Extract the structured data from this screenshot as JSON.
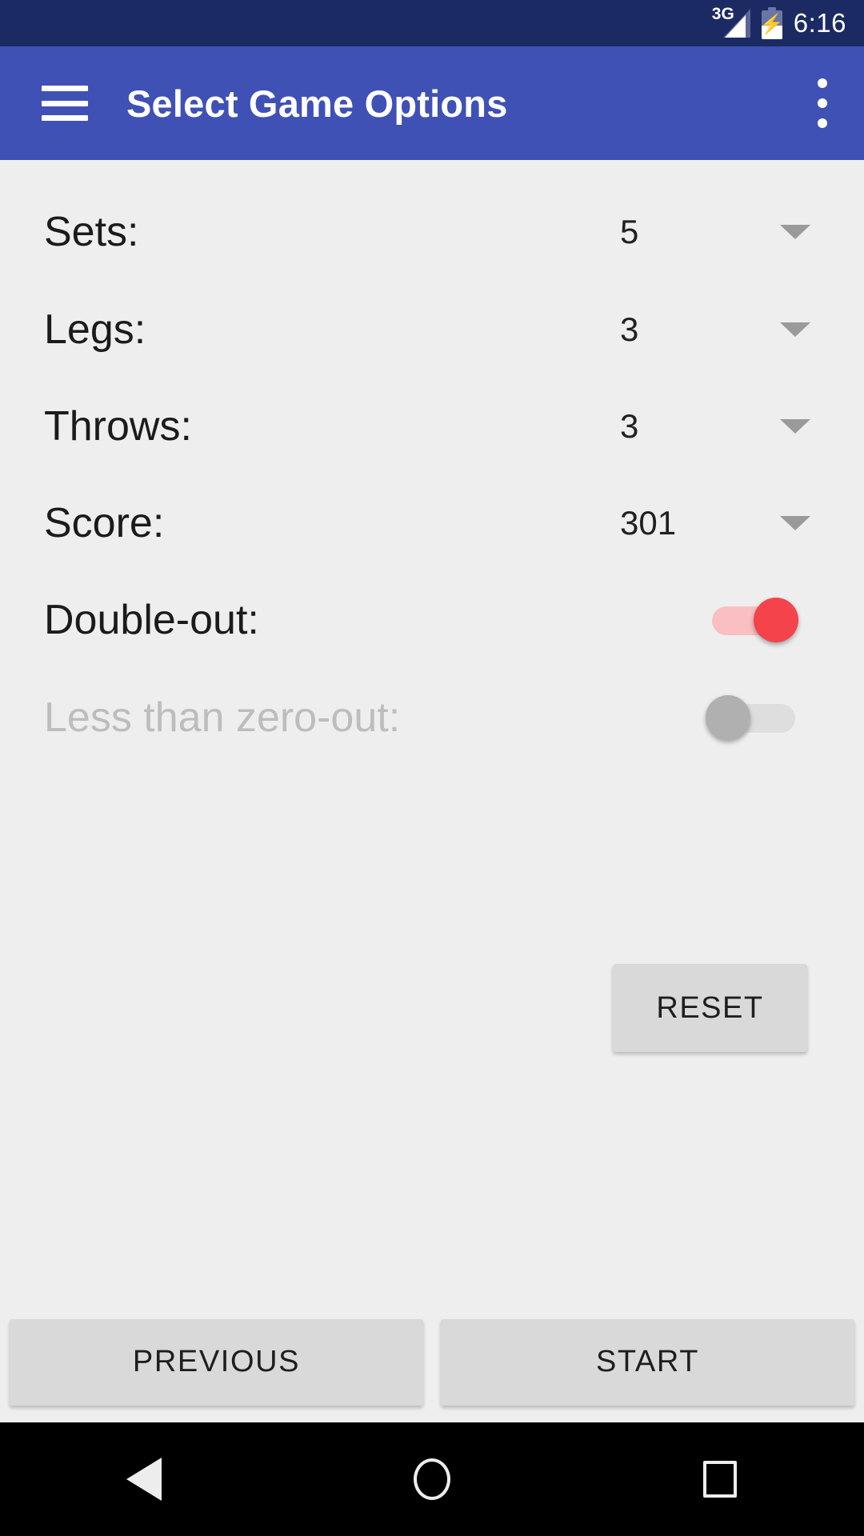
{
  "status_bar": {
    "network_label": "3G",
    "battery_state": "charging",
    "time": "6:16",
    "background_color": "#1c2a63"
  },
  "app_bar": {
    "title": "Select Game Options",
    "menu_icon": "hamburger-menu-icon",
    "overflow_icon": "overflow-menu-icon",
    "background_color": "#3f51b5"
  },
  "options": [
    {
      "label": "Sets:",
      "value": "5",
      "control": "dropdown",
      "disabled": false
    },
    {
      "label": "Legs:",
      "value": "3",
      "control": "dropdown",
      "disabled": false
    },
    {
      "label": "Throws:",
      "value": "3",
      "control": "dropdown",
      "disabled": false
    },
    {
      "label": "Score:",
      "value": "301",
      "control": "dropdown",
      "disabled": false
    },
    {
      "label": "Double-out:",
      "value": "on",
      "control": "switch",
      "disabled": false
    },
    {
      "label": "Less than zero-out:",
      "value": "off",
      "control": "switch",
      "disabled": true
    }
  ],
  "reset_button": {
    "label": "RESET"
  },
  "bottom_buttons": {
    "previous_label": "PREVIOUS",
    "start_label": "START"
  },
  "system_nav": {
    "back": "back-icon",
    "home": "home-icon",
    "recents": "recents-icon"
  },
  "colors": {
    "toggle_on_thumb": "#f4434a",
    "toggle_on_track": "#f9bfc2",
    "toggle_off_thumb": "#b0b0b0",
    "toggle_off_track": "#dedede",
    "page_background": "#eeeeee",
    "button_background": "#d9d9d9"
  }
}
